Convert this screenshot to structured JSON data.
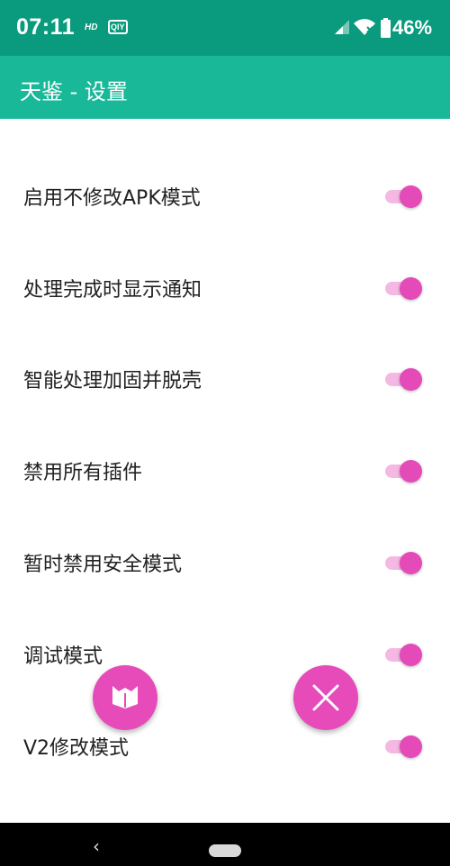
{
  "status_bar": {
    "time": "07:11",
    "hd_badge": "HD",
    "iqiyi_badge": "QIY",
    "battery_percent": "46%"
  },
  "app_bar": {
    "title": "天鉴 - 设置"
  },
  "settings": [
    {
      "label": "启用不修改APK模式",
      "enabled": true
    },
    {
      "label": "处理完成时显示通知",
      "enabled": true
    },
    {
      "label": "智能处理加固并脱壳",
      "enabled": true
    },
    {
      "label": "禁用所有插件",
      "enabled": true
    },
    {
      "label": "暂时禁用安全模式",
      "enabled": true
    },
    {
      "label": "调试模式",
      "enabled": true
    },
    {
      "label": "V2修改模式",
      "enabled": true
    }
  ],
  "fabs": {
    "left_icon": "fox-book-icon",
    "right_icon": "close-icon"
  },
  "colors": {
    "status_bar": "#0a9a7d",
    "app_bar": "#18b898",
    "accent": "#e64bb9",
    "toggle_track": "#f4b8e2"
  }
}
